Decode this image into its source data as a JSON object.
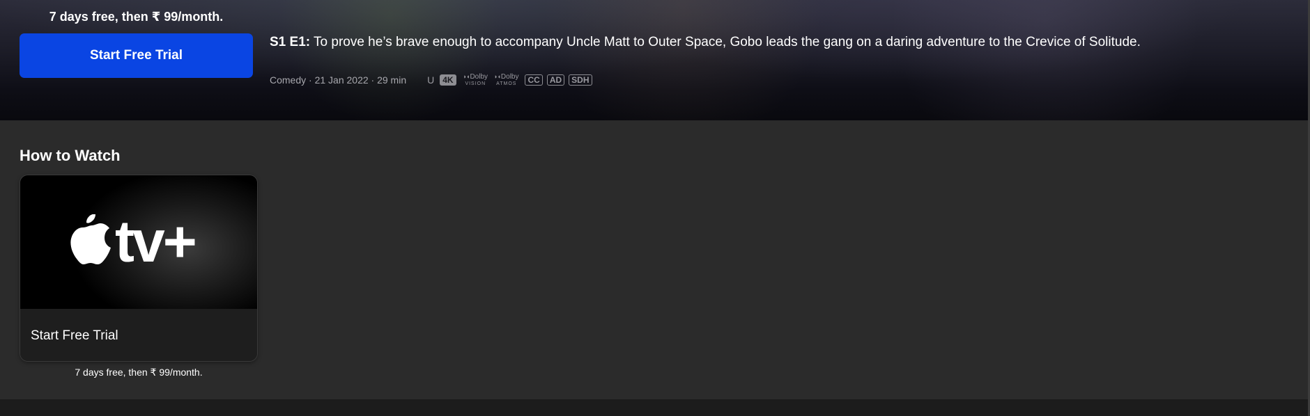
{
  "hero": {
    "offer_text": "7 days free, then ₹ 99/month.",
    "cta_label": "Start Free Trial",
    "episode_tag": "S1 E1:",
    "episode_description": "To prove he’s brave enough to accompany Uncle Matt to Outer Space, Gobo leads the gang on a daring adventure to the Crevice of Solitude.",
    "meta_text": "Comedy · 21 Jan 2022 · 29 min",
    "rating": "U",
    "badges": {
      "resolution": "4K",
      "dolby_vision_top": "Dolby",
      "dolby_vision_sub": "VISION",
      "dolby_atmos_top": "Dolby",
      "dolby_atmos_sub": "ATMOS",
      "cc": "CC",
      "ad": "AD",
      "sdh": "SDH"
    },
    "accent_color": "#0a45e3"
  },
  "how_to_watch": {
    "title": "How to Watch",
    "channel": {
      "logo_icon": "apple-tv-plus-logo",
      "logo_text": "tv+",
      "action_label": "Start Free Trial",
      "caption": "7 days free, then ₹ 99/month."
    }
  }
}
